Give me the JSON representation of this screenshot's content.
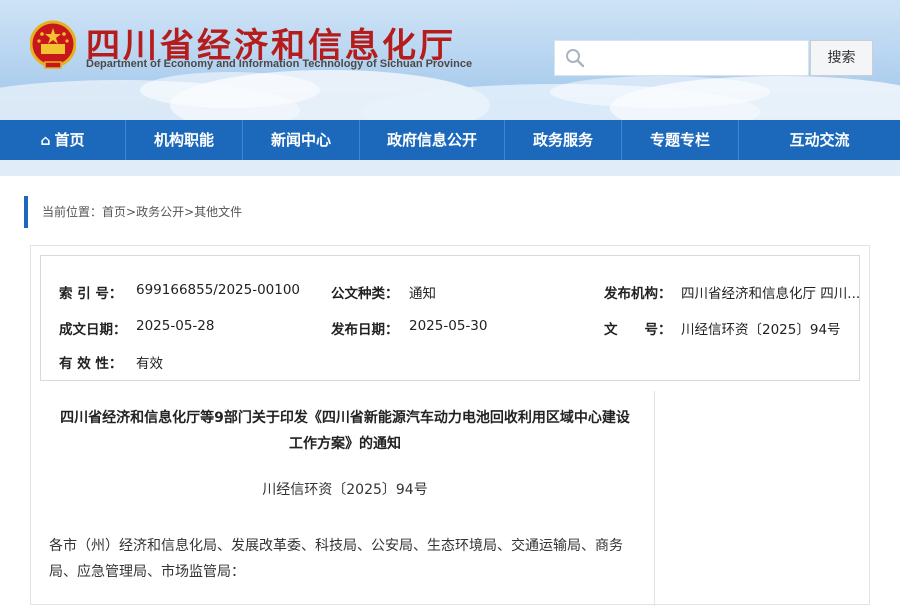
{
  "header": {
    "title_cn": "四川省经济和信息化厅",
    "title_en": "Department of Economy and Information Technology of Sichuan Province",
    "search_placeholder": "",
    "search_button": "搜索"
  },
  "nav": {
    "items": [
      "首页",
      "机构职能",
      "新闻中心",
      "政府信息公开",
      "政务服务",
      "专题专栏",
      "互动交流"
    ]
  },
  "breadcrumb": {
    "prefix": "当前位置：",
    "items": [
      "首页",
      "政务公开",
      "其他文件"
    ],
    "separator": ">"
  },
  "meta": {
    "index_label": "索 引 号：",
    "index_value": "699166855/2025-00100",
    "type_label": "公文种类：",
    "type_value": "通知",
    "publisher_label": "发布机构：",
    "publisher_value": "四川省经济和信息化厅 四川...",
    "created_label": "成文日期：",
    "created_value": "2025-05-28",
    "published_label": "发布日期：",
    "published_value": "2025-05-30",
    "docno_label": "文　　号：",
    "docno_value": "川经信环资〔2025〕94号",
    "validity_label": "有 效 性：",
    "validity_value": "有效"
  },
  "document": {
    "title": "四川省经济和信息化厅等9部门关于印发《四川省新能源汽车动力电池回收利用区域中心建设工作方案》的通知",
    "number": "川经信环资〔2025〕94号",
    "body": "各市（州）经济和信息化局、发展改革委、科技局、公安局、生态环境局、交通运输局、商务局、应急管理局、市场监管局："
  },
  "colors": {
    "nav_blue": "#1c69bb",
    "title_red": "#b51d1d",
    "accent_bar": "#1c69bb"
  },
  "icons": {
    "emblem": "national-emblem-icon",
    "search": "search-icon",
    "home": "home-icon"
  }
}
